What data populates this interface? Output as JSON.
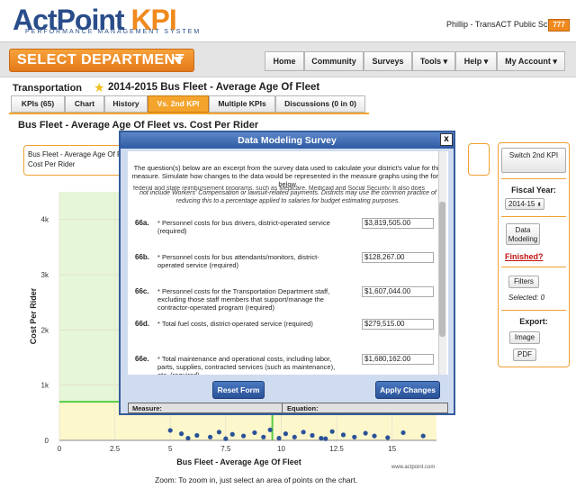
{
  "app": {
    "logo_main": "ActPoint",
    "logo_kpi": "KPI",
    "tagline": "PERFORMANCE MANAGEMENT SYSTEM",
    "user": "Phillip - TransACT Public Schools",
    "user_badge": "777"
  },
  "nav": {
    "select_department": "SELECT DEPARTMENT",
    "items": [
      "Home",
      "Community",
      "Surveys",
      "Tools ▾",
      "Help ▾",
      "My Account ▾"
    ]
  },
  "page": {
    "department": "Transportation",
    "kpi_title": "2014-2015 Bus Fleet - Average Age Of Fleet",
    "tabs": [
      "KPIs (65)",
      "Chart",
      "History",
      "Vs. 2nd KPI",
      "Multiple KPIs",
      "Discussions (0 in 0)"
    ],
    "active_tab": 3,
    "chart_heading": "Bus Fleet - Average Age Of Fleet vs. Cost Per Rider",
    "legend_text": "Bus Fleet - Average Age Of F... Cost Per Rider",
    "zoom_note": "Zoom: To zoom in, just select an area of points on the chart.",
    "watermark": "www.actpoint.com"
  },
  "chart_data": {
    "type": "scatter",
    "xlabel": "Bus Fleet - Average Age Of Fleet",
    "ylabel": "Cost Per Rider",
    "xlim": [
      0,
      17
    ],
    "ylim": [
      0,
      4500
    ],
    "x_ticks": [
      "0",
      "2.5",
      "5",
      "7.5",
      "10",
      "12.5",
      "15"
    ],
    "y_ticks": [
      "0",
      "1k",
      "2k",
      "3k",
      "4k"
    ],
    "reference_x": 9.6,
    "reference_y": 700,
    "point_color": "#2a5298",
    "points": [
      [
        5.0,
        180
      ],
      [
        5.5,
        120
      ],
      [
        6.2,
        90
      ],
      [
        6.8,
        60
      ],
      [
        7.2,
        150
      ],
      [
        7.8,
        110
      ],
      [
        8.3,
        80
      ],
      [
        8.8,
        140
      ],
      [
        9.2,
        60
      ],
      [
        9.5,
        190
      ],
      [
        10.2,
        120
      ],
      [
        10.6,
        60
      ],
      [
        11.0,
        150
      ],
      [
        11.4,
        90
      ],
      [
        11.8,
        40
      ],
      [
        12.3,
        160
      ],
      [
        12.8,
        100
      ],
      [
        13.3,
        60
      ],
      [
        13.8,
        130
      ],
      [
        14.2,
        80
      ],
      [
        14.8,
        50
      ],
      [
        15.5,
        140
      ],
      [
        16.4,
        80
      ],
      [
        5.8,
        40
      ],
      [
        7.5,
        30
      ],
      [
        9.9,
        40
      ],
      [
        12.0,
        30
      ]
    ]
  },
  "sidebar": {
    "switch_kpi": "Switch 2nd KPI",
    "fiscal_label": "Fiscal Year:",
    "fiscal_value": "2014-15",
    "data_modeling": "Data Modeling",
    "finished": "Finished?",
    "filters": "Filters",
    "selected": "Selected: 0",
    "export_label": "Export:",
    "image": "Image",
    "pdf": "PDF"
  },
  "modal": {
    "title": "Data Modeling Survey",
    "close": "x",
    "intro": "The question(s) below are an excerpt from the survey data used to calculate your district's value for this measure. Simulate how changes to the data would be represented in the measure graphs using the form below.",
    "cut_line": "federal and state reimbursement programs, such as Medicare, Medicaid and Social Security. It also does",
    "note": "not include Workers' Compensation or lawsuit-related payments. Districts may use the common practice of reducing this to a percentage applied to salaries for budget estimating purposes.",
    "questions": [
      {
        "num": "66a.",
        "text": "* Personnel costs for bus drivers, district-operated service (required)",
        "value": "$3,819,505.00"
      },
      {
        "num": "66b.",
        "text": "* Personnel costs for bus attendants/monitors, district-operated service (required)",
        "value": "$128,267.00"
      },
      {
        "num": "66c.",
        "text": "* Personnel costs for the Transportation Department staff, excluding those staff members that support/manage the contractor-operated program (required)",
        "value": "$1,607,044.00"
      },
      {
        "num": "66d.",
        "text": "* Total fuel costs, district-operated service (required)",
        "value": "$279,515.00"
      },
      {
        "num": "66e.",
        "text": "* Total maintenance and operational costs, including labor, parts, supplies, contracted services (such as maintenance), etc. (required)",
        "value": "$1,680,162.00"
      }
    ],
    "reset": "Reset Form",
    "apply": "Apply Changes",
    "measure_label": "Measure:",
    "equation_label": "Equation:"
  }
}
